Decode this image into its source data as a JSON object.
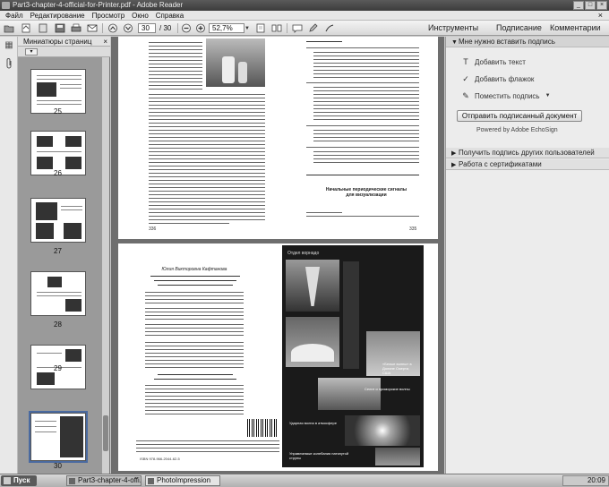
{
  "window": {
    "title": "Part3-chapter-4-official-for-Printer.pdf - Adobe Reader",
    "btn_min": "_",
    "btn_max": "□",
    "btn_close": "×"
  },
  "menu": {
    "file": "Файл",
    "edit": "Редактирование",
    "view": "Просмотр",
    "window": "Окно",
    "help": "Справка",
    "close": "×"
  },
  "toolbar": {
    "current_page": "30",
    "total_pages": "/ 30",
    "zoom": "52,7%",
    "tools": "Инструменты",
    "sign": "Подписание",
    "comments": "Комментарии"
  },
  "thumbnails": {
    "title": "Миниатюры страниц",
    "close": "×",
    "pages": [
      "25",
      "26",
      "27",
      "28",
      "29",
      "30"
    ],
    "selected": "30"
  },
  "right_pane": {
    "section_sign": "Мне нужно вставить подпись",
    "add_text": "Добавить текст",
    "add_check": "Добавить флажок",
    "place_sign": "Поместить подпись",
    "send_button": "Отправить подписанный документ",
    "powered": "Powered by Adobe EchoSign",
    "section_get": "Получить подпись других пользователей",
    "section_certs": "Работа с сертификатами"
  },
  "document": {
    "toc_heading": "Начальные периодические сигналы",
    "toc_heading2": "для визуализации",
    "page_number_left": "336",
    "page_number_right": "335",
    "cover_top": "Отдел ворнадо",
    "cover_mid1": "Селит и приморские волны",
    "cover_mid2": "«Белые волны» в Долине Смерти, США",
    "cover_mid3": "Ударная волна в атмосфере",
    "cover_bottom": "Управляемые колебания натянутой струны",
    "isbn": "ISBN 978-966-2044-62-5",
    "author": "Юлия Викторовна Кафтанова"
  },
  "taskbar": {
    "start": "Пуск",
    "task1": "Part3-chapter-4-offi...",
    "task2": "PhotoImpression",
    "time": "20:09"
  },
  "icons": {
    "open": "folder-open-icon",
    "save": "save-icon",
    "print": "print-icon",
    "mail": "mail-icon",
    "up": "page-up-icon",
    "down": "page-down-icon",
    "zoom_out": "zoom-out-icon",
    "zoom_in": "zoom-in-icon"
  }
}
